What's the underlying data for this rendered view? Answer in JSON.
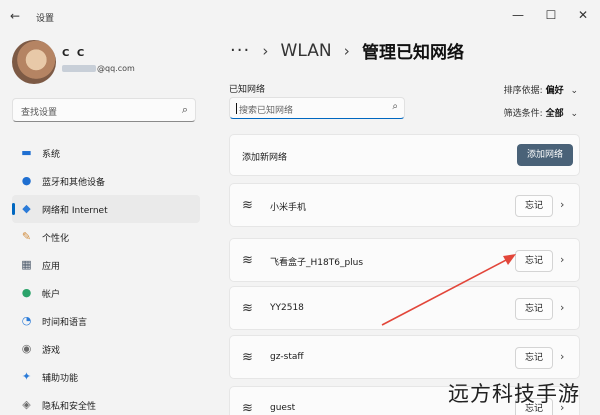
{
  "window": {
    "title": "设置",
    "back_glyph": "←",
    "minimize_glyph": "—",
    "maximize_glyph": "☐",
    "close_glyph": "✕"
  },
  "profile": {
    "name": "C C",
    "email_suffix": "@qq.com"
  },
  "sidebar_search": {
    "placeholder": "查找设置",
    "icon": "search-icon"
  },
  "nav": {
    "items": [
      {
        "label": "系统",
        "icon": "system-icon",
        "color": "#1f6fd1",
        "glyph": "▬"
      },
      {
        "label": "蓝牙和其他设备",
        "icon": "bluetooth-icon",
        "color": "#1f6fd1",
        "glyph": "●"
      },
      {
        "label": "网络和 Internet",
        "icon": "network-icon",
        "color": "#2b7bd8",
        "glyph": "◆"
      },
      {
        "label": "个性化",
        "icon": "personalization-icon",
        "color": "#d08a3a",
        "glyph": "✎"
      },
      {
        "label": "应用",
        "icon": "apps-icon",
        "color": "#4c5a6b",
        "glyph": "▦"
      },
      {
        "label": "帐户",
        "icon": "account-icon",
        "color": "#2ba36a",
        "glyph": "●"
      },
      {
        "label": "时间和语言",
        "icon": "time-language-icon",
        "color": "#2b7bd8",
        "glyph": "◔"
      },
      {
        "label": "游戏",
        "icon": "gaming-icon",
        "color": "#6b6b6b",
        "glyph": "◉"
      },
      {
        "label": "辅助功能",
        "icon": "accessibility-icon",
        "color": "#2b7bd8",
        "glyph": "✦"
      },
      {
        "label": "隐私和安全性",
        "icon": "privacy-icon",
        "color": "#6b6b6b",
        "glyph": "◈"
      }
    ],
    "active_index": 2
  },
  "breadcrumb": {
    "ellipsis": "···",
    "separator": "›",
    "parent": "WLAN",
    "current": "管理已知网络"
  },
  "known": {
    "section_label": "已知网络",
    "search_placeholder": "搜索已知网络",
    "sort_label": "排序依据:",
    "sort_value": "偏好",
    "filter_label": "筛选条件:",
    "filter_value": "全部",
    "add_label": "添加新网络",
    "add_button": "添加网络",
    "networks": [
      {
        "name": "小米手机",
        "forget": "忘记"
      },
      {
        "name": "飞看盒子_H18T6_plus",
        "forget": "忘记"
      },
      {
        "name": "YY2518",
        "forget": "忘记"
      },
      {
        "name": "gz-staff",
        "forget": "忘记"
      },
      {
        "name": "guest",
        "forget": "忘记"
      }
    ]
  },
  "annotation": {
    "arrow_color": "#e2463a"
  },
  "watermark": "远方科技手游"
}
